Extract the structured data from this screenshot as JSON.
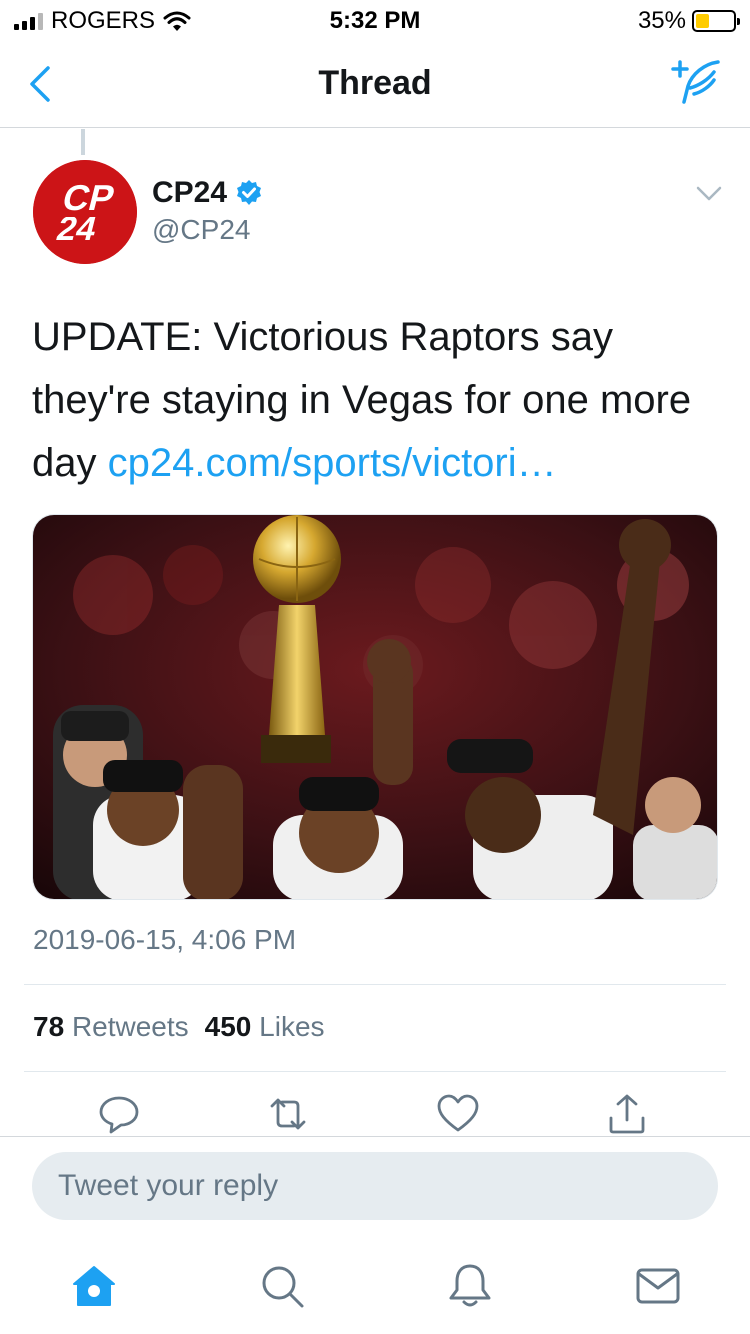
{
  "status_bar": {
    "carrier": "ROGERS",
    "time": "5:32 PM",
    "battery": "35%",
    "battery_level": 0.35
  },
  "nav": {
    "title": "Thread",
    "back_icon": "chevron-left-icon",
    "compose_icon": "compose-tweet-icon"
  },
  "tweet": {
    "display_name": "CP24",
    "handle": "@CP24",
    "verified": true,
    "avatar_text_top": "CP",
    "avatar_text_bottom": "24",
    "text": "UPDATE: Victorious Raptors say they're staying in Vegas for one more day ",
    "link": "cp24.com/sports/victori…",
    "timestamp": "2019-06-15, 4:06 PM",
    "retweets": "78",
    "retweets_label": "Retweets",
    "likes": "450",
    "likes_label": "Likes"
  },
  "reply": {
    "placeholder": "Tweet your reply"
  },
  "colors": {
    "accent": "#1da1f2",
    "avatar_red": "#cc1417",
    "muted_text": "#657786"
  },
  "tabs": [
    {
      "name": "home",
      "icon": "home-icon",
      "active": true
    },
    {
      "name": "search",
      "icon": "search-icon",
      "active": false
    },
    {
      "name": "notifications",
      "icon": "bell-icon",
      "active": false
    },
    {
      "name": "messages",
      "icon": "envelope-icon",
      "active": false
    }
  ]
}
